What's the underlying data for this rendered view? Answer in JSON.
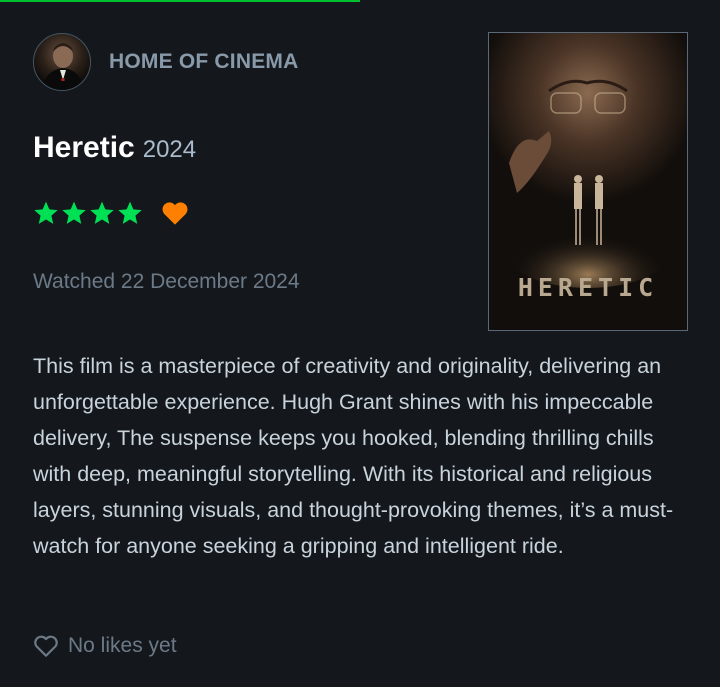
{
  "header": {
    "username": "HOME OF CINEMA"
  },
  "film": {
    "title": "Heretic",
    "year": "2024",
    "poster_title": "HERETIC"
  },
  "rating": {
    "stars": 4,
    "max_stars": 5,
    "liked": true,
    "star_color": "#00e054",
    "like_color": "#ff8000"
  },
  "watched": {
    "text": "Watched 22 December 2024"
  },
  "review": {
    "text": "This film is a masterpiece of creativity and originality, delivering an unforgettable experience. Hugh Grant shines with his impeccable delivery, The suspense keeps you hooked, blending thrilling chills with deep, meaningful storytelling. With its historical and religious layers, stunning visuals, and thought-provoking themes, it’s a must-watch for anyone seeking a gripping and intelligent ride."
  },
  "likes": {
    "text": "No likes yet"
  },
  "colors": {
    "background": "#14181c",
    "accent_green": "#00c030",
    "heading": "#ffffff",
    "muted": "#6c7a88"
  }
}
